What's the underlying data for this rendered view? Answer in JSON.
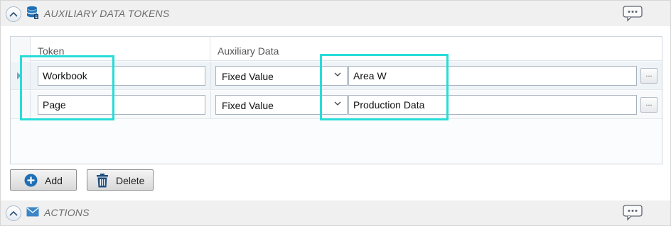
{
  "aux_section": {
    "title": "AUXILIARY DATA TOKENS",
    "icons": {
      "collapse": "chevron-up-icon",
      "section": "database-icon",
      "comment": "comment-icon"
    }
  },
  "grid": {
    "columns": {
      "token": "Token",
      "aux": "Auxiliary Data"
    },
    "rows": [
      {
        "token": "Workbook",
        "type": "Fixed Value",
        "value": "Area W",
        "ellipsis": "..."
      },
      {
        "token": "Page",
        "type": "Fixed Value",
        "value": "Production Data",
        "ellipsis": "..."
      }
    ]
  },
  "buttons": {
    "add": "Add",
    "delete": "Delete"
  },
  "actions_section": {
    "title": "ACTIONS",
    "icons": {
      "collapse": "chevron-up-icon",
      "section": "envelope-icon",
      "comment": "comment-icon"
    }
  },
  "colors": {
    "highlight": "#27dcd8",
    "accent": "#1f6fb5",
    "header_bg": "#f0f0f0"
  }
}
